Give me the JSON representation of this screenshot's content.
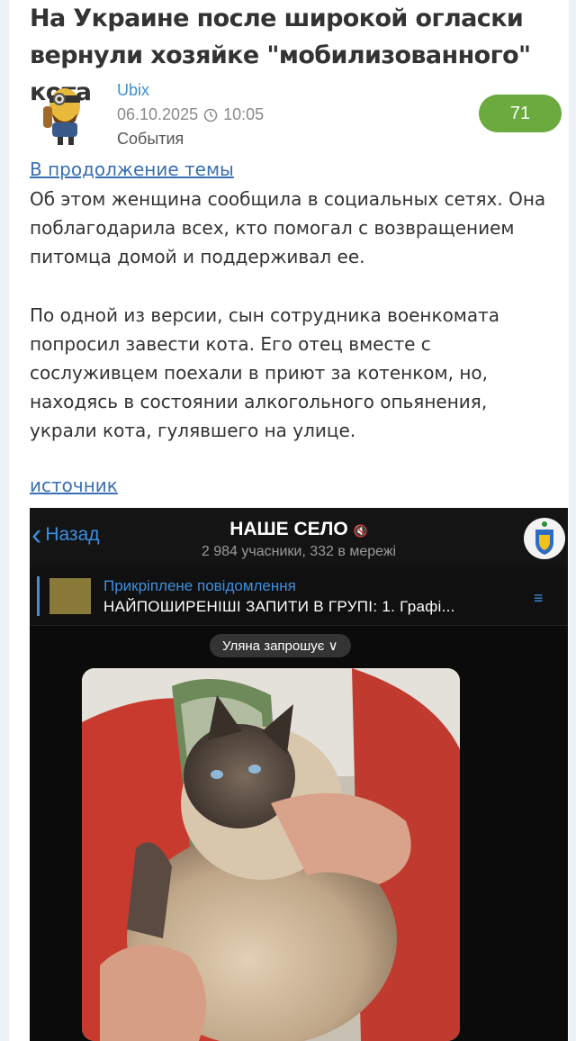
{
  "article": {
    "title": "На Украине после широкой огласки вернули хозяйке \"мобилизованного\" кота",
    "author": "Ubix",
    "date": "06.10.2025",
    "time": "10:05",
    "category": "События",
    "comment_count": "71",
    "continuation_link": "В продолжение темы",
    "paragraph1": "Об этом женщина сообщила в социальных сетях. Она поблагодарила всех, кто помогал с возвращением питомца домой и поддерживал ее.",
    "paragraph2": "По одной из версии, сын сотрудника военкомата попросил завести кота. Его отец вместе с сослуживцем поехали в приют за котенком, но, находясь в состоянии алкогольного опьянения, украли кота, гулявшего на улице.",
    "source_link": "источник"
  },
  "embedded_screenshot": {
    "back_label": "Назад",
    "group_title": "НАШЕ СЕЛО",
    "group_subtitle": "2 984 учасники, 332 в мережі",
    "pinned_label": "Прикріплене повідомлення",
    "pinned_text": "НАЙПОШИРЕНІШІ ЗАПИТИ В ГРУПІ: 1. Графі...",
    "invite_text": "Уляна запрошує ∨"
  },
  "colors": {
    "accent_link": "#3d8fd0",
    "badge": "#6aaa3e",
    "telegram_blue": "#3d8fe0"
  },
  "icons": [
    "avatar-icon",
    "clock-icon",
    "back-chevron-icon",
    "mute-icon",
    "pin-list-icon"
  ]
}
